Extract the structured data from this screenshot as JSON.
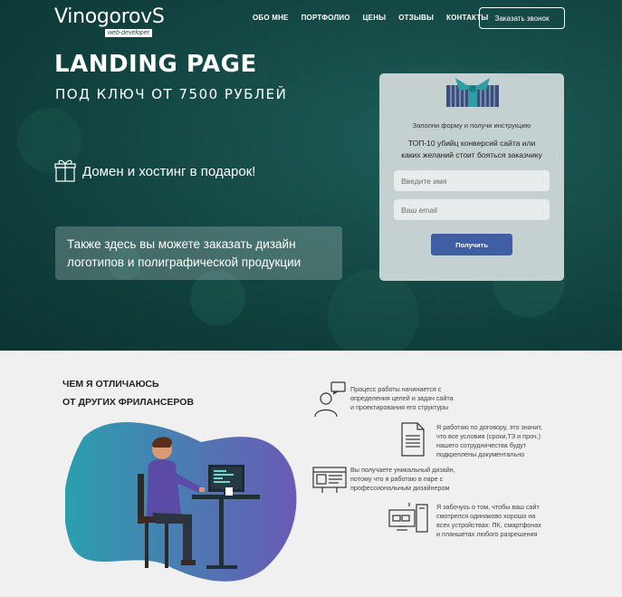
{
  "header": {
    "logo_name": "VinogorovS",
    "logo_sub": "web-developer",
    "nav": [
      {
        "label": "ОБО МНЕ"
      },
      {
        "label": "ПОРТФОЛИО"
      },
      {
        "label": "ЦЕНЫ"
      },
      {
        "label": "ОТЗЫВЫ"
      },
      {
        "label": "КОНТАКТЫ"
      }
    ],
    "callback_label": "Заказать звонок"
  },
  "hero": {
    "title": "LANDING PAGE",
    "subtitle": "ПОД КЛЮЧ ОТ 7500 РУБЛЕЙ",
    "gift_text": "Домен и хостинг в подарок!",
    "info_line1": "Также здесь вы можете заказать дизайн",
    "info_line2": "логотипов и полиграфической продукции"
  },
  "form": {
    "hint": "Заполни форму и получи инструкцию",
    "head_line1": "ТОП-10 убийц конверсий сайта или",
    "head_line2": "каких желаний стоит бояться заказчику",
    "name_placeholder": "Введите имя",
    "email_placeholder": "Ваш email",
    "submit_label": "Получить"
  },
  "section": {
    "title_line1": "ЧЕМ Я ОТЛИЧАЮСЬ",
    "title_line2": "ОТ ДРУГИХ ФРИЛАНСЕРОВ",
    "features": [
      {
        "lines": [
          "Процесс работы начинается с",
          "определения целей и задач сайта",
          "и проектирования его структуры"
        ]
      },
      {
        "lines": [
          "Я работаю по договору, это значит,",
          "что все условия (сроки,ТЗ и проч.)",
          "нашего сотрудничества будут",
          "подкреплены документально"
        ]
      },
      {
        "lines": [
          "Вы получаете уникальный дизайн,",
          "потому что я работаю в паре с",
          "профессиональным дизайнером"
        ]
      },
      {
        "lines": [
          "Я забочусь о том, чтобы ваш сайт",
          "смотрелся одинаково хорошо на",
          "всех устройствах: ПК, смартфонах",
          "и планшетах любого разрешения"
        ]
      }
    ]
  },
  "colors": {
    "hero_bg": "#174d49",
    "button_blue": "#3f5ea3",
    "form_bg": "#c4d1d0",
    "blob_start": "#2a9fae",
    "blob_end": "#6a5ab5"
  }
}
